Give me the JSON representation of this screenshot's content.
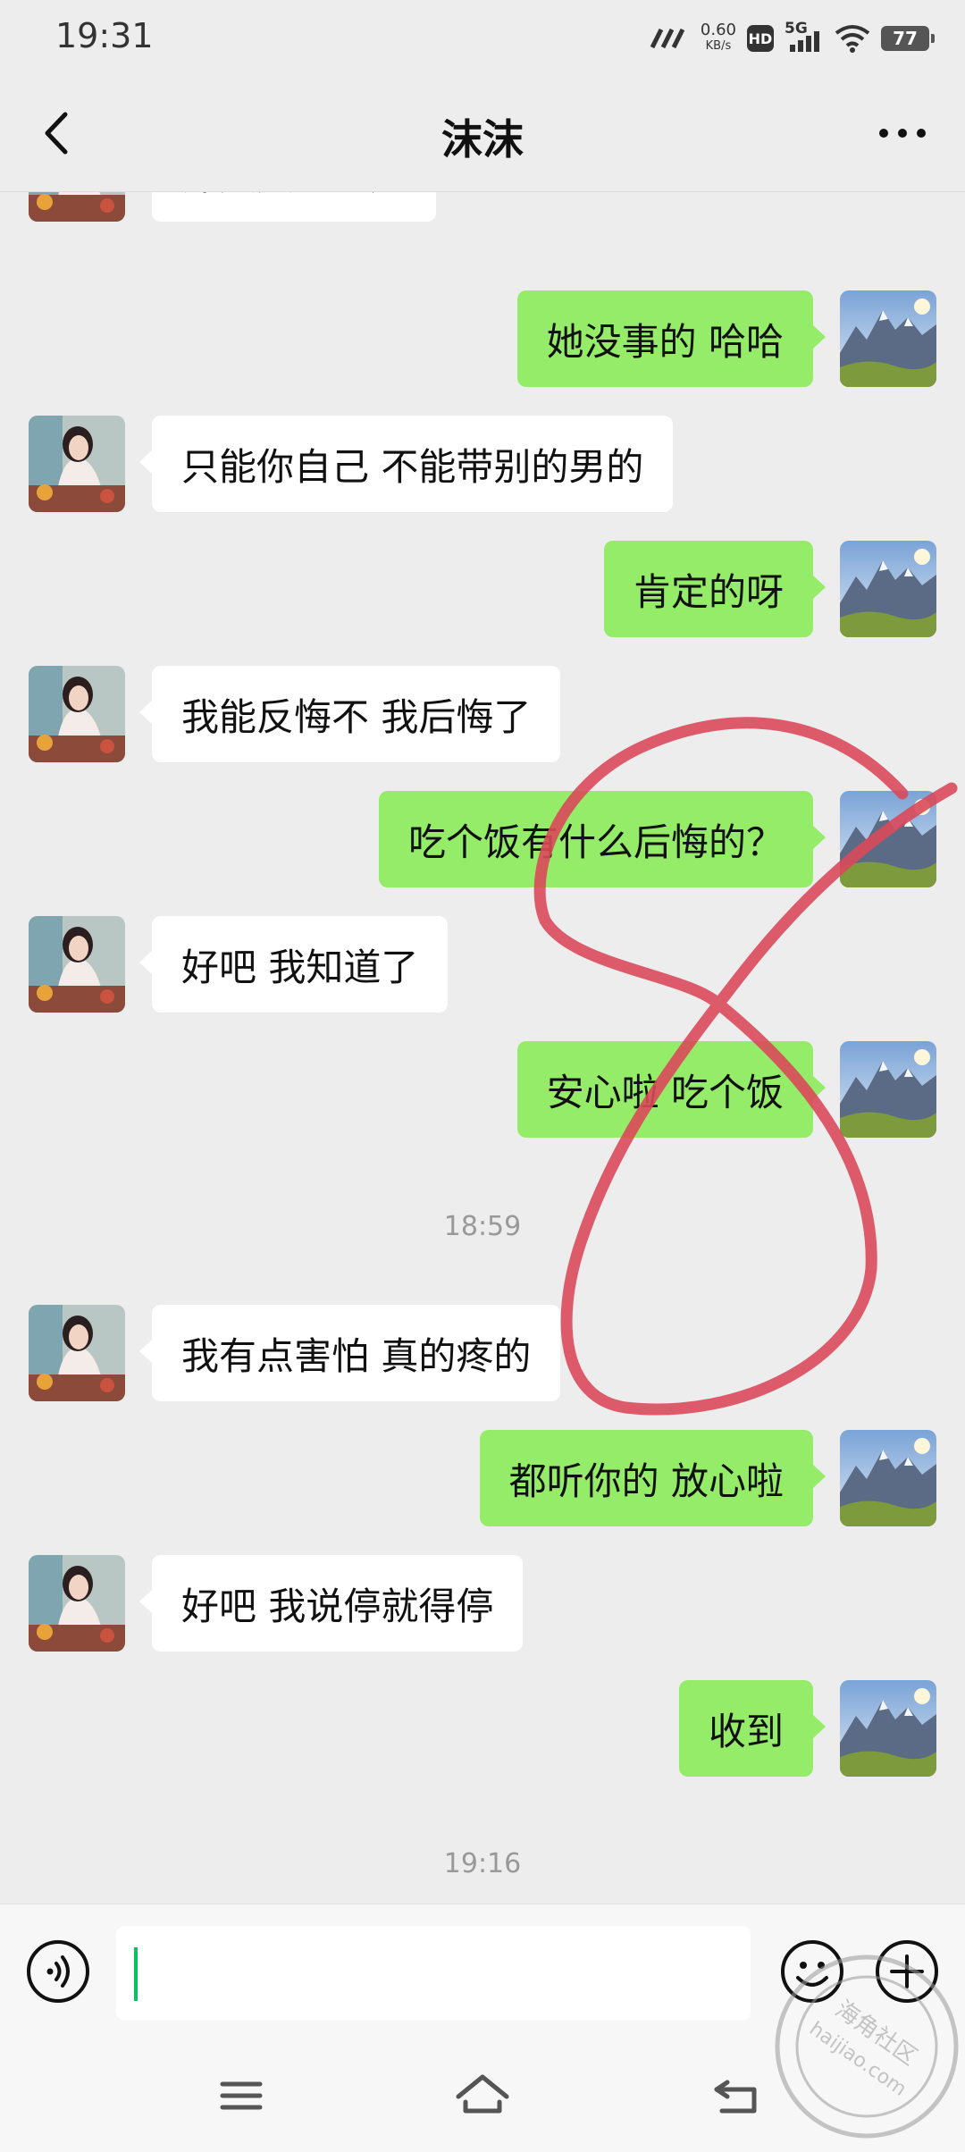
{
  "status_bar": {
    "time": "19:31",
    "net_speed_value": "0.60",
    "net_speed_unit": "KB/s",
    "hd": "HD",
    "network": "5G",
    "battery": "77"
  },
  "header": {
    "title": "沫沫"
  },
  "messages": [
    {
      "side": "in",
      "text": "那文文怎么办"
    },
    {
      "side": "out",
      "text": "她没事的  哈哈"
    },
    {
      "side": "in",
      "text": "只能你自己 不能带别的男的"
    },
    {
      "side": "out",
      "text": "肯定的呀"
    },
    {
      "side": "in",
      "text": "我能反悔不  我后悔了"
    },
    {
      "side": "out",
      "text": "吃个饭有什么后悔的？"
    },
    {
      "side": "in",
      "text": "好吧  我知道了"
    },
    {
      "side": "out",
      "text": "安心啦  吃个饭"
    },
    {
      "side": "in",
      "text": "我有点害怕  真的疼的"
    },
    {
      "side": "out",
      "text": "都听你的 放心啦"
    },
    {
      "side": "in",
      "text": "好吧  我说停就得停"
    },
    {
      "side": "out",
      "text": "收到"
    }
  ],
  "timestamps": [
    "18:59",
    "19:16"
  ],
  "input": {
    "value": "",
    "placeholder": ""
  },
  "watermark": {
    "text": "海角社区",
    "url": "haijiao.com"
  },
  "colors": {
    "outgoing_bubble": "#95ec69",
    "incoming_bubble": "#ffffff",
    "background": "#ededed",
    "annotation": "#d9495a"
  }
}
